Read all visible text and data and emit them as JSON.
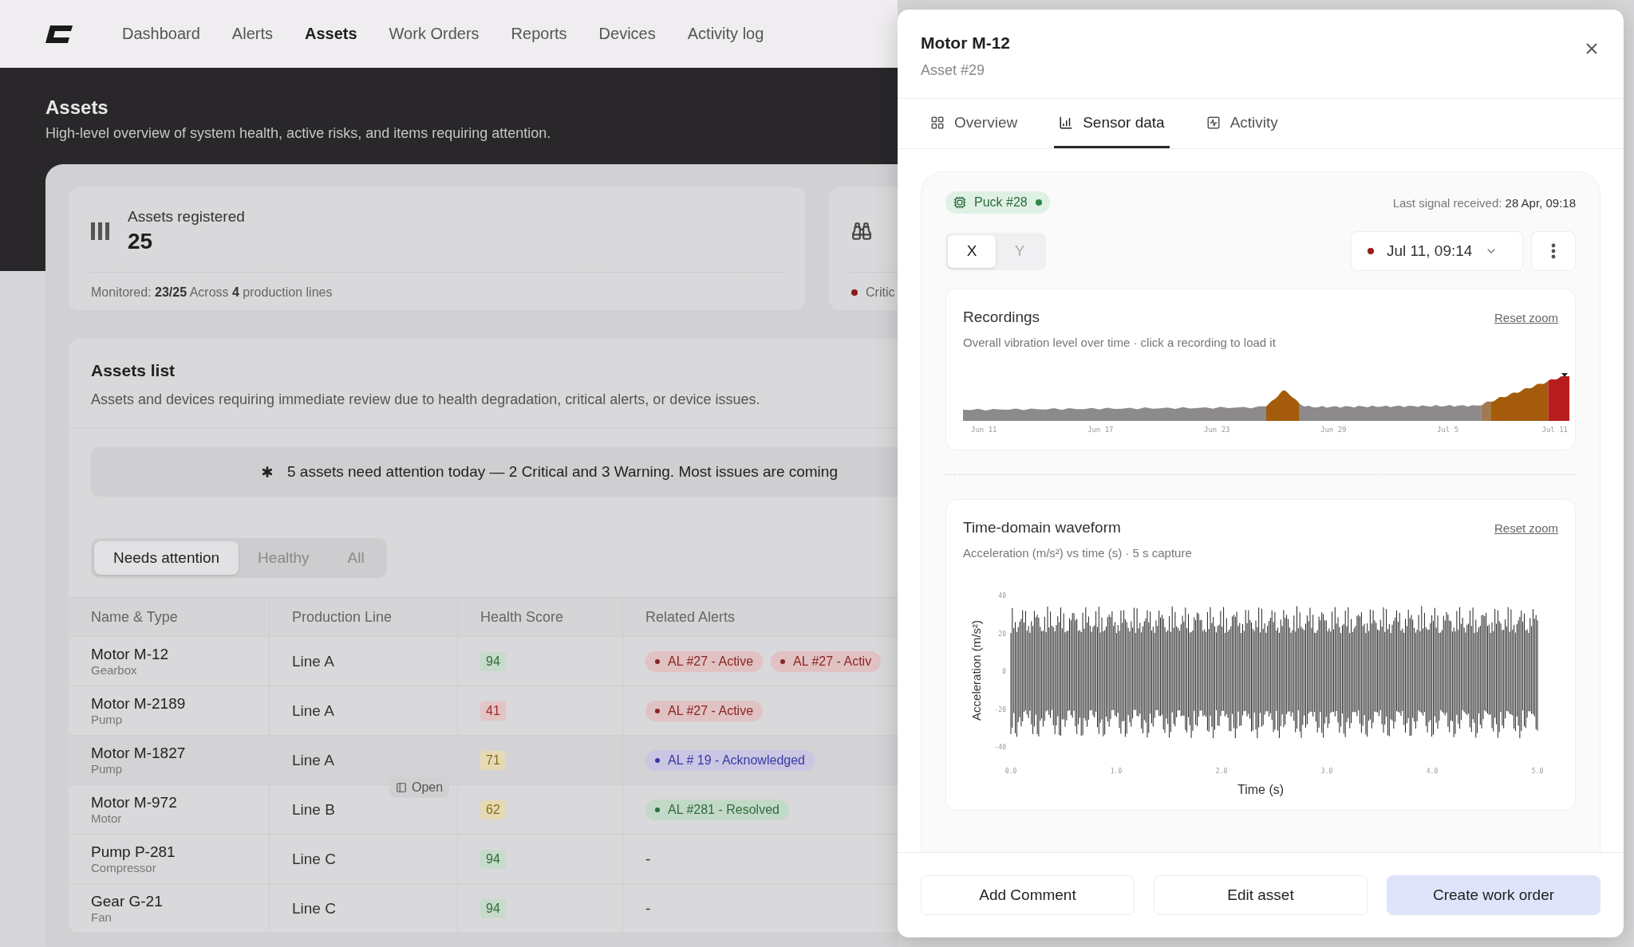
{
  "nav": {
    "items": [
      {
        "label": "Dashboard",
        "selected": false
      },
      {
        "label": "Alerts",
        "selected": false
      },
      {
        "label": "Assets",
        "selected": true
      },
      {
        "label": "Work Orders",
        "selected": false
      },
      {
        "label": "Reports",
        "selected": false
      },
      {
        "label": "Devices",
        "selected": false
      },
      {
        "label": "Activity log",
        "selected": false
      }
    ]
  },
  "page_header": {
    "title": "Assets",
    "subtitle": "High-level overview of system health, active risks, and items requiring attention."
  },
  "stat_cards": [
    {
      "kind": "registered",
      "title": "Assets registered",
      "value": "25",
      "footnote": "Monitored: **23/25** Across **4** production lines"
    },
    {
      "kind": "critical",
      "footnote": "Critic"
    }
  ],
  "assets_list": {
    "title": "Assets list",
    "description": "Assets and devices requiring immediate review due to health degradation, critical alerts, or device issues.",
    "banner": "5 assets need attention today — 2 Critical and 3 Warning. Most issues are coming",
    "filters": [
      {
        "label": "Needs attention",
        "selected": true
      },
      {
        "label": "Healthy",
        "selected": false
      },
      {
        "label": "All",
        "selected": false
      }
    ],
    "columns": [
      "Name & Type",
      "Production Line",
      "Health Score",
      "Related Alerts"
    ],
    "rows": [
      {
        "name": "Motor M-12",
        "type": "Gearbox",
        "line": "Line A",
        "score": "94",
        "kind": "good",
        "alerts": [
          {
            "label": "AL #27 - Active",
            "kind": "active"
          },
          {
            "label": "AL #27 - Activ",
            "kind": "active"
          }
        ]
      },
      {
        "name": "Motor M-2189",
        "type": "Pump",
        "line": "Line A",
        "score": "41",
        "kind": "critical",
        "alerts": [
          {
            "label": "AL #27 - Active",
            "kind": "active"
          }
        ]
      },
      {
        "name": "Motor M-1827",
        "type": "Pump",
        "line": "Line A",
        "score": "71",
        "kind": "warning",
        "alerts": [
          {
            "label": "AL # 19 - Acknowledged",
            "kind": "acknowledged"
          }
        ],
        "hover_action": "Open"
      },
      {
        "name": "Motor M-972",
        "type": "Motor",
        "line": "Line B",
        "score": "62",
        "kind": "warning",
        "alerts": [
          {
            "label": "AL #281 - Resolved",
            "kind": "resolved"
          }
        ]
      },
      {
        "name": "Pump P-281",
        "type": "Compressor",
        "line": "Line C",
        "score": "94",
        "kind": "good",
        "no_alerts": "-"
      },
      {
        "name": "Gear G-21",
        "type": "Fan",
        "line": "Line C",
        "score": "94",
        "kind": "good",
        "no_alerts": "-"
      }
    ]
  },
  "drawer": {
    "title": "Motor M-12",
    "subtitle": "Asset #29",
    "tabs": [
      {
        "label": "Overview",
        "selected": false
      },
      {
        "label": "Sensor data",
        "selected": true
      },
      {
        "label": "Activity",
        "selected": false
      }
    ],
    "device": {
      "label": "Puck #28",
      "online": true
    },
    "last_signal": "Last signal received: **28 Apr, 09:18**",
    "axes": [
      {
        "label": "X",
        "selected": true
      },
      {
        "label": "Y",
        "selected": false
      }
    ],
    "recording": "Jul 11, 09:14",
    "recordings": {
      "title": "Recordings",
      "reset": "Reset zoom",
      "description": "Overall vibration level over time · click a recording to load it",
      "x_ticks": [
        "Jun 11",
        "Jun 17",
        "Jun 23",
        "Jun 29",
        "Jul 5",
        "Jul 11"
      ]
    },
    "waveform": {
      "title": "Time-domain waveform",
      "reset": "Reset zoom",
      "description": "Acceleration (m/s²) vs time (s) · 5 s capture",
      "ylabel": "Acceleration (m/s²)",
      "xlabel": "Time (s)",
      "y_ticks": [
        "40",
        "20",
        "0",
        "-20",
        "-40"
      ],
      "x_ticks": [
        "0.0",
        "1.0",
        "2.0",
        "3.0",
        "4.0",
        "5.0"
      ]
    },
    "buttons": [
      {
        "label": "Add Comment",
        "primary": false
      },
      {
        "label": "Edit asset",
        "primary": false
      },
      {
        "label": "Create work order",
        "primary": true
      }
    ]
  }
}
